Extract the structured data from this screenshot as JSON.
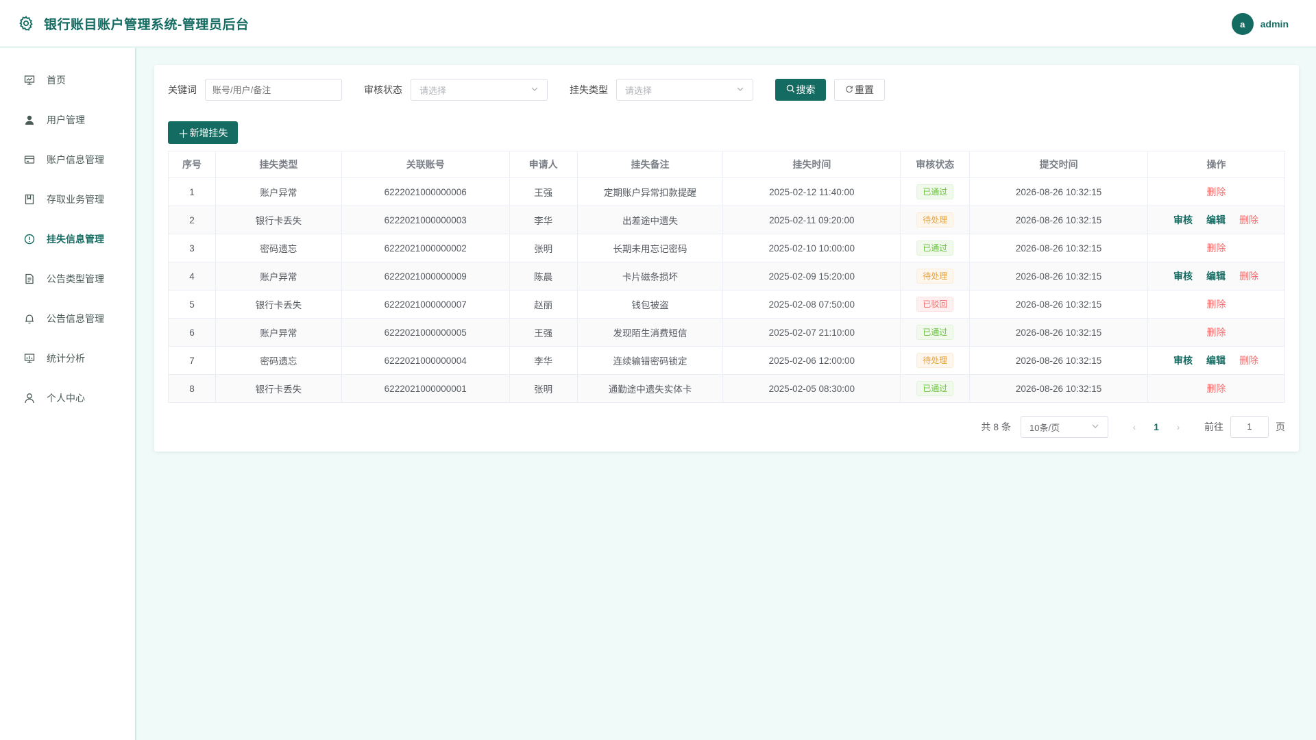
{
  "header": {
    "title": "银行账目账户管理系统-管理员后台",
    "avatar_letter": "a",
    "username": "admin"
  },
  "sidebar": {
    "items": [
      {
        "label": "首页",
        "icon": "presentation-board-icon",
        "active": false
      },
      {
        "label": "用户管理",
        "icon": "user-icon",
        "active": false
      },
      {
        "label": "账户信息管理",
        "icon": "credit-card-icon",
        "active": false
      },
      {
        "label": "存取业务管理",
        "icon": "notebook-icon",
        "active": false
      },
      {
        "label": "挂失信息管理",
        "icon": "warning-circle-icon",
        "active": true
      },
      {
        "label": "公告类型管理",
        "icon": "document-icon",
        "active": false
      },
      {
        "label": "公告信息管理",
        "icon": "bell-icon",
        "active": false
      },
      {
        "label": "统计分析",
        "icon": "chart-board-icon",
        "active": false
      },
      {
        "label": "个人中心",
        "icon": "person-icon",
        "active": false
      }
    ]
  },
  "filters": {
    "keyword_label": "关键词",
    "keyword_placeholder": "账号/用户/备注",
    "status_label": "审核状态",
    "status_placeholder": "请选择",
    "type_label": "挂失类型",
    "type_placeholder": "请选择",
    "search_label": "搜索",
    "reset_label": "重置"
  },
  "add_button": "新增挂失",
  "table": {
    "columns": [
      "序号",
      "挂失类型",
      "关联账号",
      "申请人",
      "挂失备注",
      "挂失时间",
      "审核状态",
      "提交时间",
      "操作"
    ],
    "rows": [
      {
        "no": "1",
        "type": "账户异常",
        "account": "6222021000000006",
        "applicant": "王强",
        "remark": "定期账户异常扣款提醒",
        "loss_time": "2025-02-12 11:40:00",
        "status": "已通过",
        "status_kind": "ok",
        "submit_time": "2026-08-26 10:32:15"
      },
      {
        "no": "2",
        "type": "银行卡丢失",
        "account": "6222021000000003",
        "applicant": "李华",
        "remark": "出差途中遗失",
        "loss_time": "2025-02-11 09:20:00",
        "status": "待处理",
        "status_kind": "pending",
        "submit_time": "2026-08-26 10:32:15"
      },
      {
        "no": "3",
        "type": "密码遗忘",
        "account": "6222021000000002",
        "applicant": "张明",
        "remark": "长期未用忘记密码",
        "loss_time": "2025-02-10 10:00:00",
        "status": "已通过",
        "status_kind": "ok",
        "submit_time": "2026-08-26 10:32:15"
      },
      {
        "no": "4",
        "type": "账户异常",
        "account": "6222021000000009",
        "applicant": "陈晨",
        "remark": "卡片磁条损坏",
        "loss_time": "2025-02-09 15:20:00",
        "status": "待处理",
        "status_kind": "pending",
        "submit_time": "2026-08-26 10:32:15"
      },
      {
        "no": "5",
        "type": "银行卡丢失",
        "account": "6222021000000007",
        "applicant": "赵丽",
        "remark": "钱包被盗",
        "loss_time": "2025-02-08 07:50:00",
        "status": "已驳回",
        "status_kind": "rejected",
        "submit_time": "2026-08-26 10:32:15"
      },
      {
        "no": "6",
        "type": "账户异常",
        "account": "6222021000000005",
        "applicant": "王强",
        "remark": "发现陌生消费短信",
        "loss_time": "2025-02-07 21:10:00",
        "status": "已通过",
        "status_kind": "ok",
        "submit_time": "2026-08-26 10:32:15"
      },
      {
        "no": "7",
        "type": "密码遗忘",
        "account": "6222021000000004",
        "applicant": "李华",
        "remark": "连续输错密码锁定",
        "loss_time": "2025-02-06 12:00:00",
        "status": "待处理",
        "status_kind": "pending",
        "submit_time": "2026-08-26 10:32:15"
      },
      {
        "no": "8",
        "type": "银行卡丢失",
        "account": "6222021000000001",
        "applicant": "张明",
        "remark": "通勤途中遗失实体卡",
        "loss_time": "2025-02-05 08:30:00",
        "status": "已通过",
        "status_kind": "ok",
        "submit_time": "2026-08-26 10:32:15"
      }
    ],
    "op_audit": "审核",
    "op_edit": "编辑",
    "op_delete": "删除"
  },
  "pagination": {
    "total_text": "共 8 条",
    "page_size": "10条/页",
    "current_page": "1",
    "goto_label": "前往",
    "goto_value": "1",
    "page_suffix": "页"
  },
  "colors": {
    "primary": "#146b62",
    "ok": "#67c23a",
    "pending": "#e6a23c",
    "danger": "#f56c6c",
    "background": "#f0faf8"
  }
}
